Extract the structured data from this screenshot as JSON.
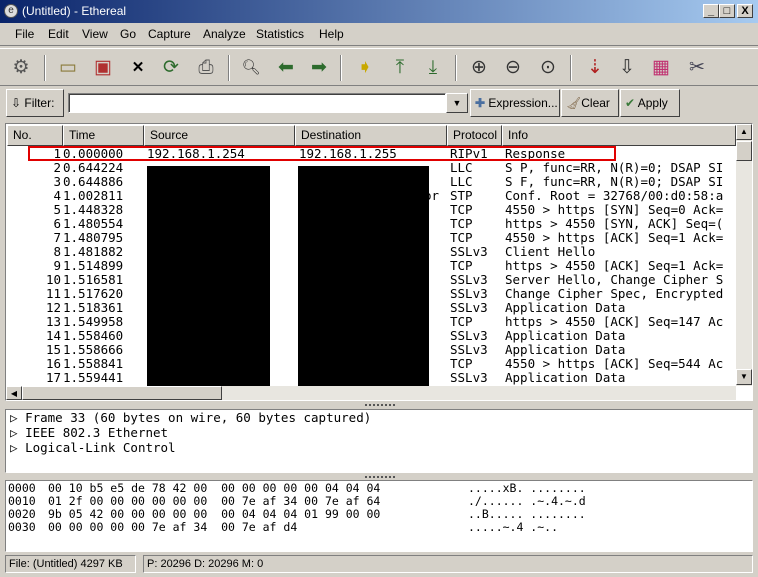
{
  "window": {
    "title": "(Untitled) - Ethereal",
    "controls": [
      "_",
      "□",
      "X"
    ]
  },
  "menu": [
    "File",
    "Edit",
    "View",
    "Go",
    "Capture",
    "Analyze",
    "Statistics",
    "Help"
  ],
  "toolbar": [
    "interfaces-icon",
    "open-icon",
    "save-icon",
    "close-icon",
    "reload-icon",
    "print-icon",
    "find-icon",
    "back-icon",
    "forward-icon",
    "goto-icon",
    "first-icon",
    "last-icon",
    "zoom-in-icon",
    "zoom-out-icon",
    "zoom-100-icon",
    "capture-filter-icon",
    "display-filter-icon",
    "coloring-icon",
    "preferences-icon"
  ],
  "filter": {
    "label": "Filter:",
    "value": "",
    "expression": "Expression...",
    "clear": "Clear",
    "apply": "Apply"
  },
  "packet_list": {
    "columns": [
      "No. ",
      "Time",
      "Source",
      "Destination",
      "Protocol",
      "Info"
    ],
    "rows": [
      [
        "1",
        "0.000000",
        "192.168.1.254",
        "192.168.1.255",
        "RIPv1",
        "Response"
      ],
      [
        "2",
        "0.644224",
        "",
        "",
        "LLC",
        "S P, func=RR, N(R)=0; DSAP SI"
      ],
      [
        "3",
        "0.644886",
        "",
        "",
        "LLC",
        "S F, func=RR, N(R)=0; DSAP SI"
      ],
      [
        "4",
        "1.002811",
        "",
        "or",
        "STP",
        "Conf. Root = 32768/00:d0:58:a"
      ],
      [
        "5",
        "1.448328",
        "",
        "",
        "TCP",
        "4550 > https [SYN] Seq=0 Ack="
      ],
      [
        "6",
        "1.480554",
        "",
        "",
        "TCP",
        "https > 4550 [SYN, ACK] Seq=("
      ],
      [
        "7",
        "1.480795",
        "",
        "",
        "TCP",
        "4550 > https [ACK] Seq=1 Ack="
      ],
      [
        "8",
        "1.481882",
        "",
        "",
        "SSLv3",
        "Client Hello"
      ],
      [
        "9",
        "1.514899",
        "",
        "",
        "TCP",
        "https > 4550 [ACK] Seq=1 Ack="
      ],
      [
        "10",
        "1.516581",
        "",
        "",
        "SSLv3",
        "Server Hello, Change Cipher S"
      ],
      [
        "11",
        "1.517620",
        "",
        "",
        "SSLv3",
        "Change Cipher Spec, Encrypted"
      ],
      [
        "12",
        "1.518361",
        "",
        "",
        "SSLv3",
        "Application Data"
      ],
      [
        "13",
        "1.549958",
        "",
        "",
        "TCP",
        "https > 4550 [ACK] Seq=147 Ac"
      ],
      [
        "14",
        "1.558460",
        "",
        "",
        "SSLv3",
        "Application Data"
      ],
      [
        "15",
        "1.558666",
        "",
        "",
        "SSLv3",
        "Application Data"
      ],
      [
        "16",
        "1.558841",
        "",
        "",
        "TCP",
        "4550 > https [ACK] Seq=544 Ac"
      ],
      [
        "17",
        "1.559441",
        "",
        "",
        "SSLv3",
        "Application Data"
      ]
    ]
  },
  "details": [
    "Frame 33 (60 bytes on wire, 60 bytes captured)",
    "IEEE 802.3 Ethernet",
    "Logical-Link Control"
  ],
  "hex": [
    [
      "0000",
      "00 10 b5 e5 de 78 42 00  00 00 00 00 00 04 04 04",
      ".....xB. ........"
    ],
    [
      "0010",
      "01 2f 00 00 00 00 00 00  00 7e af 34 00 7e af 64",
      "./...... .~.4.~.d"
    ],
    [
      "0020",
      "9b 05 42 00 00 00 00 00  00 04 04 04 01 99 00 00",
      "..B..... ........"
    ],
    [
      "0030",
      "00 00 00 00 00 7e af 34  00 7e af d4",
      ".....~.4 .~.."
    ]
  ],
  "status": {
    "file": "File: (Untitled) 4297 KB",
    "counts": "P: 20296 D: 20296 M: 0"
  },
  "colors": {
    "title_start": "#0a246a",
    "title_end": "#a6caf0",
    "highlight": "#e00000",
    "chrome": "#d4d0c8"
  }
}
